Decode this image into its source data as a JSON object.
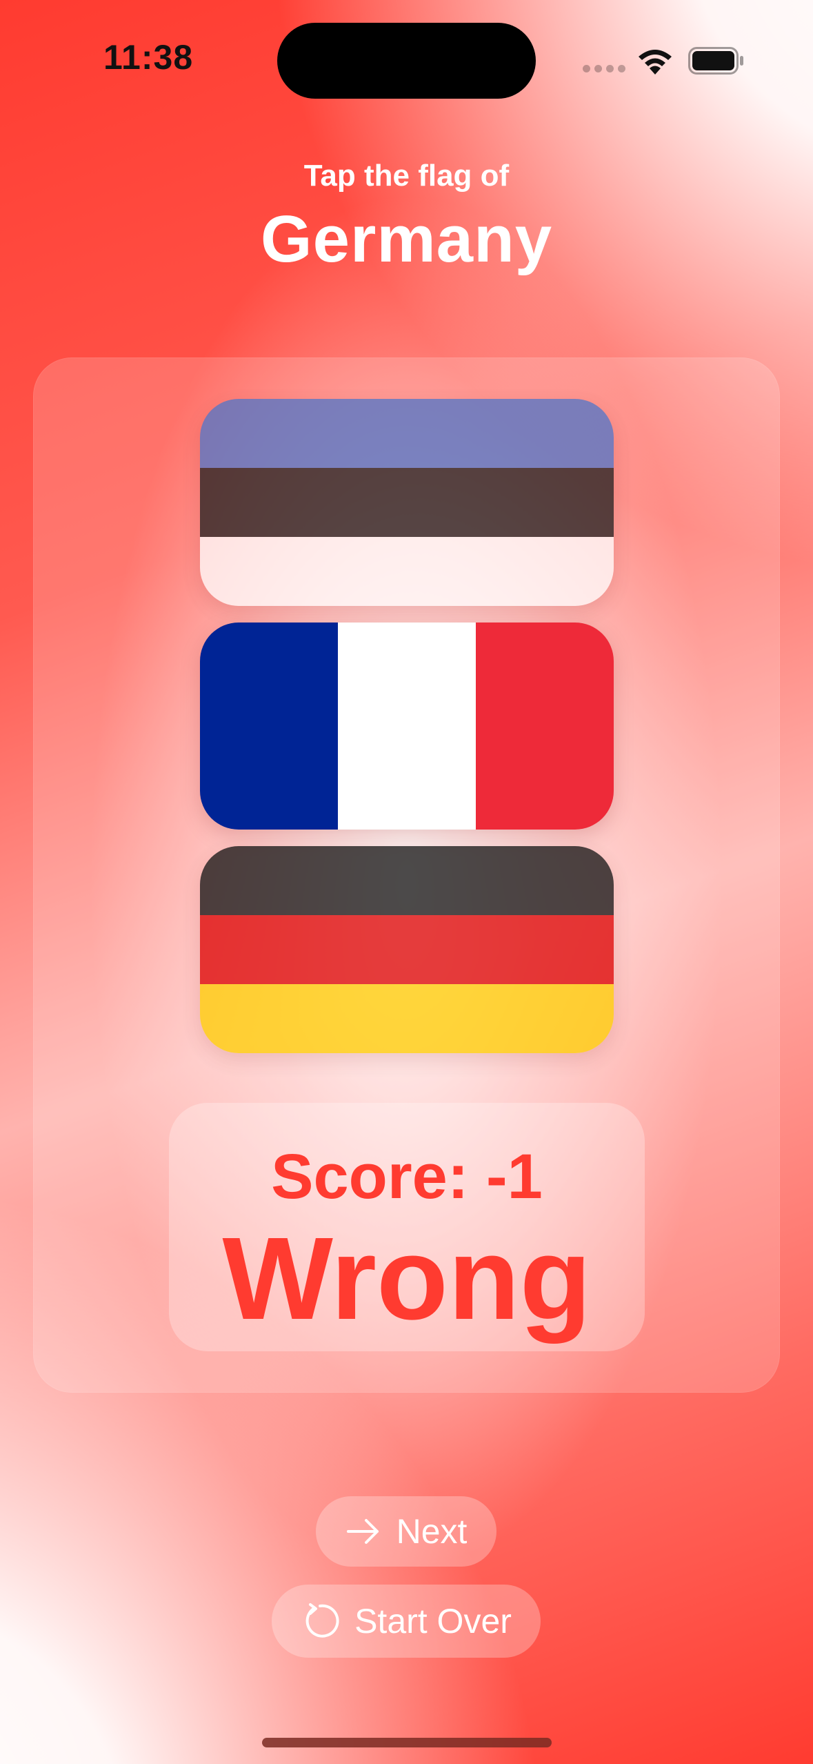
{
  "status_bar": {
    "time": "11:38",
    "icons": [
      "cellular-signal-icon",
      "wifi-icon",
      "battery-icon"
    ]
  },
  "header": {
    "prompt": "Tap the flag of",
    "country": "Germany"
  },
  "flags": [
    {
      "name": "estonia",
      "stripes": [
        "#4e75c9",
        "#1e1e1e",
        "#ffffff"
      ],
      "orientation": "horizontal",
      "dimmed": true
    },
    {
      "name": "france",
      "stripes": [
        "#002495",
        "#ffffff",
        "#ee2a39"
      ],
      "orientation": "vertical",
      "dimmed": false
    },
    {
      "name": "germany",
      "stripes": [
        "#111111",
        "#dd0000",
        "#ffce00"
      ],
      "orientation": "horizontal",
      "dimmed": true
    }
  ],
  "score": {
    "label": "Score: -1",
    "result": "Wrong"
  },
  "buttons": {
    "next_label": "Next",
    "start_over_label": "Start Over"
  },
  "colors": {
    "accent": "#ff3b30",
    "text_light": "#ffffff"
  }
}
